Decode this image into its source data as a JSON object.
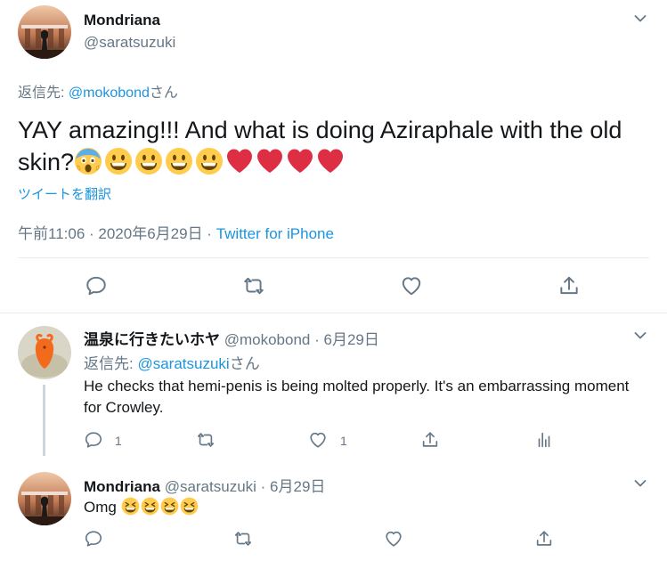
{
  "main_tweet": {
    "author_name": "Mondriana",
    "author_handle": "@saratsuzuki",
    "reply_to_prefix": "返信先: ",
    "reply_to_handle": "@mokobond",
    "reply_to_suffix": "さん",
    "text": "YAY amazing!!! And what is doing Aziraphale with the old skin?",
    "translate_link": "ツイートを翻訳",
    "time": "午前11:06 · 2020年6月29日 · ",
    "source": "Twitter for iPhone"
  },
  "replies": [
    {
      "author_name": "温泉に行きたいホヤ",
      "author_handle": "@mokobond",
      "separator": " · ",
      "date": "6月29日",
      "reply_to_prefix": "返信先: ",
      "reply_to_handle": "@saratsuzuki",
      "reply_to_suffix": "さん",
      "text": "He checks that hemi-penis is being molted properly. It's an embarrassing moment for Crowley.",
      "reply_count": "1",
      "like_count": "1"
    },
    {
      "author_name": "Mondriana",
      "author_handle": "@saratsuzuki",
      "separator": " · ",
      "date": "6月29日",
      "text": "Omg"
    }
  ],
  "colors": {
    "link": "#1b95e0",
    "muted": "#657786",
    "heart": "#e0245e",
    "emoji_yellow": "#ffcc4d"
  }
}
